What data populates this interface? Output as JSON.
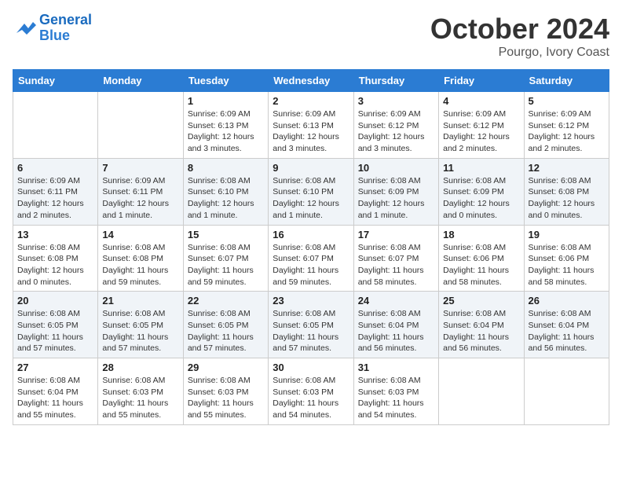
{
  "header": {
    "logo_line1": "General",
    "logo_line2": "Blue",
    "month": "October 2024",
    "location": "Pourgo, Ivory Coast"
  },
  "days_of_week": [
    "Sunday",
    "Monday",
    "Tuesday",
    "Wednesday",
    "Thursday",
    "Friday",
    "Saturday"
  ],
  "weeks": [
    [
      {
        "day": "",
        "info": ""
      },
      {
        "day": "",
        "info": ""
      },
      {
        "day": "1",
        "info": "Sunrise: 6:09 AM\nSunset: 6:13 PM\nDaylight: 12 hours\nand 3 minutes."
      },
      {
        "day": "2",
        "info": "Sunrise: 6:09 AM\nSunset: 6:13 PM\nDaylight: 12 hours\nand 3 minutes."
      },
      {
        "day": "3",
        "info": "Sunrise: 6:09 AM\nSunset: 6:12 PM\nDaylight: 12 hours\nand 3 minutes."
      },
      {
        "day": "4",
        "info": "Sunrise: 6:09 AM\nSunset: 6:12 PM\nDaylight: 12 hours\nand 2 minutes."
      },
      {
        "day": "5",
        "info": "Sunrise: 6:09 AM\nSunset: 6:12 PM\nDaylight: 12 hours\nand 2 minutes."
      }
    ],
    [
      {
        "day": "6",
        "info": "Sunrise: 6:09 AM\nSunset: 6:11 PM\nDaylight: 12 hours\nand 2 minutes."
      },
      {
        "day": "7",
        "info": "Sunrise: 6:09 AM\nSunset: 6:11 PM\nDaylight: 12 hours\nand 1 minute."
      },
      {
        "day": "8",
        "info": "Sunrise: 6:08 AM\nSunset: 6:10 PM\nDaylight: 12 hours\nand 1 minute."
      },
      {
        "day": "9",
        "info": "Sunrise: 6:08 AM\nSunset: 6:10 PM\nDaylight: 12 hours\nand 1 minute."
      },
      {
        "day": "10",
        "info": "Sunrise: 6:08 AM\nSunset: 6:09 PM\nDaylight: 12 hours\nand 1 minute."
      },
      {
        "day": "11",
        "info": "Sunrise: 6:08 AM\nSunset: 6:09 PM\nDaylight: 12 hours\nand 0 minutes."
      },
      {
        "day": "12",
        "info": "Sunrise: 6:08 AM\nSunset: 6:08 PM\nDaylight: 12 hours\nand 0 minutes."
      }
    ],
    [
      {
        "day": "13",
        "info": "Sunrise: 6:08 AM\nSunset: 6:08 PM\nDaylight: 12 hours\nand 0 minutes."
      },
      {
        "day": "14",
        "info": "Sunrise: 6:08 AM\nSunset: 6:08 PM\nDaylight: 11 hours\nand 59 minutes."
      },
      {
        "day": "15",
        "info": "Sunrise: 6:08 AM\nSunset: 6:07 PM\nDaylight: 11 hours\nand 59 minutes."
      },
      {
        "day": "16",
        "info": "Sunrise: 6:08 AM\nSunset: 6:07 PM\nDaylight: 11 hours\nand 59 minutes."
      },
      {
        "day": "17",
        "info": "Sunrise: 6:08 AM\nSunset: 6:07 PM\nDaylight: 11 hours\nand 58 minutes."
      },
      {
        "day": "18",
        "info": "Sunrise: 6:08 AM\nSunset: 6:06 PM\nDaylight: 11 hours\nand 58 minutes."
      },
      {
        "day": "19",
        "info": "Sunrise: 6:08 AM\nSunset: 6:06 PM\nDaylight: 11 hours\nand 58 minutes."
      }
    ],
    [
      {
        "day": "20",
        "info": "Sunrise: 6:08 AM\nSunset: 6:05 PM\nDaylight: 11 hours\nand 57 minutes."
      },
      {
        "day": "21",
        "info": "Sunrise: 6:08 AM\nSunset: 6:05 PM\nDaylight: 11 hours\nand 57 minutes."
      },
      {
        "day": "22",
        "info": "Sunrise: 6:08 AM\nSunset: 6:05 PM\nDaylight: 11 hours\nand 57 minutes."
      },
      {
        "day": "23",
        "info": "Sunrise: 6:08 AM\nSunset: 6:05 PM\nDaylight: 11 hours\nand 57 minutes."
      },
      {
        "day": "24",
        "info": "Sunrise: 6:08 AM\nSunset: 6:04 PM\nDaylight: 11 hours\nand 56 minutes."
      },
      {
        "day": "25",
        "info": "Sunrise: 6:08 AM\nSunset: 6:04 PM\nDaylight: 11 hours\nand 56 minutes."
      },
      {
        "day": "26",
        "info": "Sunrise: 6:08 AM\nSunset: 6:04 PM\nDaylight: 11 hours\nand 56 minutes."
      }
    ],
    [
      {
        "day": "27",
        "info": "Sunrise: 6:08 AM\nSunset: 6:04 PM\nDaylight: 11 hours\nand 55 minutes."
      },
      {
        "day": "28",
        "info": "Sunrise: 6:08 AM\nSunset: 6:03 PM\nDaylight: 11 hours\nand 55 minutes."
      },
      {
        "day": "29",
        "info": "Sunrise: 6:08 AM\nSunset: 6:03 PM\nDaylight: 11 hours\nand 55 minutes."
      },
      {
        "day": "30",
        "info": "Sunrise: 6:08 AM\nSunset: 6:03 PM\nDaylight: 11 hours\nand 54 minutes."
      },
      {
        "day": "31",
        "info": "Sunrise: 6:08 AM\nSunset: 6:03 PM\nDaylight: 11 hours\nand 54 minutes."
      },
      {
        "day": "",
        "info": ""
      },
      {
        "day": "",
        "info": ""
      }
    ]
  ]
}
